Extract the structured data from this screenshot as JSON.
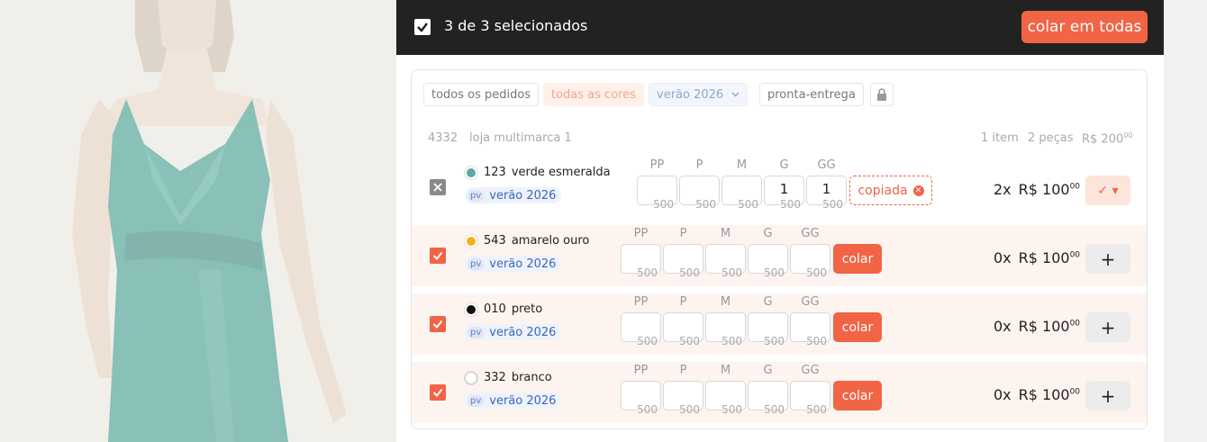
{
  "header": {
    "selected_count": "3 de 3 selecionados",
    "paste_all_label": "colar em todas"
  },
  "filters": [
    {
      "label": "todos os pedidos"
    },
    {
      "label": "todas as cores"
    },
    {
      "label": "verão 2026"
    },
    {
      "label": "pronta-entrega"
    }
  ],
  "order": {
    "number": "4332",
    "store": "loja multimarca 1",
    "items": "1 item",
    "pieces": "2 peças",
    "total_prefix": "R$ 200",
    "total_cents": "00"
  },
  "sizes": [
    "PP",
    "P",
    "M",
    "G",
    "GG"
  ],
  "paste_label": "colar",
  "copied_label": "copiada",
  "rows": [
    {
      "code": "123",
      "name": "verde esmeralda",
      "color": "#5fa6a6",
      "tag": "pv",
      "collection": "verão 2026",
      "stock": [
        "500",
        "500",
        "500",
        "500",
        "500"
      ],
      "qty": [
        "",
        "",
        "",
        "1",
        "1"
      ],
      "count": "2x",
      "price": "R$ 100",
      "cents": "00",
      "action": "✓ ▾"
    },
    {
      "code": "543",
      "name": "amarelo ouro",
      "color": "#f2b01e",
      "tag": "pv",
      "collection": "verão 2026",
      "stock": [
        "500",
        "500",
        "500",
        "500",
        "500"
      ],
      "qty": [
        "",
        "",
        "",
        "",
        ""
      ],
      "count": "0x",
      "price": "R$ 100",
      "cents": "00",
      "action": "+"
    },
    {
      "code": "010",
      "name": "preto",
      "color": "#111111",
      "tag": "pv",
      "collection": "verão 2026",
      "stock": [
        "500",
        "500",
        "500",
        "500",
        "500"
      ],
      "qty": [
        "",
        "",
        "",
        "",
        ""
      ],
      "count": "0x",
      "price": "R$ 100",
      "cents": "00",
      "action": "+"
    },
    {
      "code": "332",
      "name": "branco",
      "color": "#ffffff",
      "tag": "pv",
      "collection": "verão 2026",
      "stock": [
        "500",
        "500",
        "500",
        "500",
        "500"
      ],
      "qty": [
        "",
        "",
        "",
        "",
        ""
      ],
      "count": "0x",
      "price": "R$ 100",
      "cents": "00",
      "action": "+"
    }
  ],
  "colors": {
    "accent": "#f16445",
    "topbar": "#222222"
  }
}
